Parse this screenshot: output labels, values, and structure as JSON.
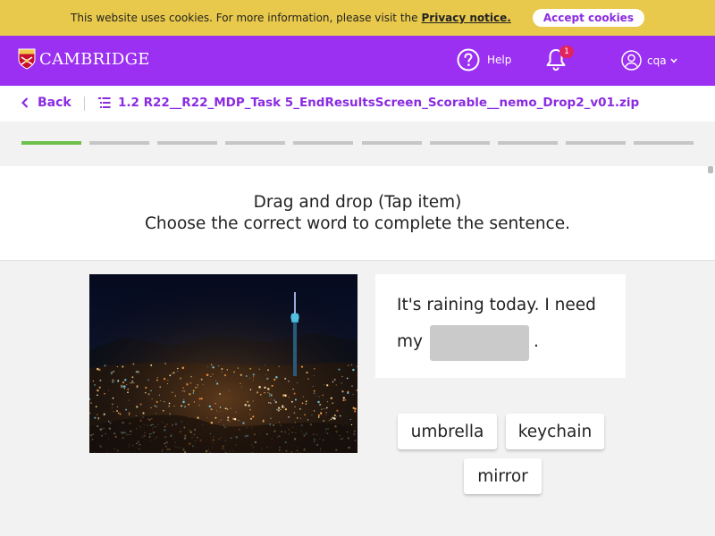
{
  "cookie": {
    "message": "This website uses cookies. For more information, please visit the",
    "privacy_link": "Privacy notice.",
    "accept_label": "Accept cookies"
  },
  "header": {
    "brand": "CAMBRIDGE",
    "help_label": "Help",
    "notification_count": "1",
    "username": "cqa"
  },
  "crumbs": {
    "back_label": "Back",
    "file_title": "1.2 R22__R22_MDP_Task 5_EndResultsScreen_Scorable__nemo_Drop2_v01.zip"
  },
  "progress": {
    "total_steps": 10,
    "current_step": 1
  },
  "instructions": {
    "line1": "Drag and drop (Tap item)",
    "line2": "Choose the correct word to complete the sentence."
  },
  "question": {
    "text_line1": "It's raining today. I need",
    "text_before_gap": "my",
    "text_after_gap": "."
  },
  "options": [
    "umbrella",
    "keychain",
    "mirror"
  ],
  "colors": {
    "cookie_bar": "#e9c94b",
    "brand_purple": "#9b2ff2",
    "link_purple": "#8a2be2",
    "progress_active": "#6cc04a",
    "progress_inactive": "#c6c6c6",
    "gap": "#cacaca"
  }
}
